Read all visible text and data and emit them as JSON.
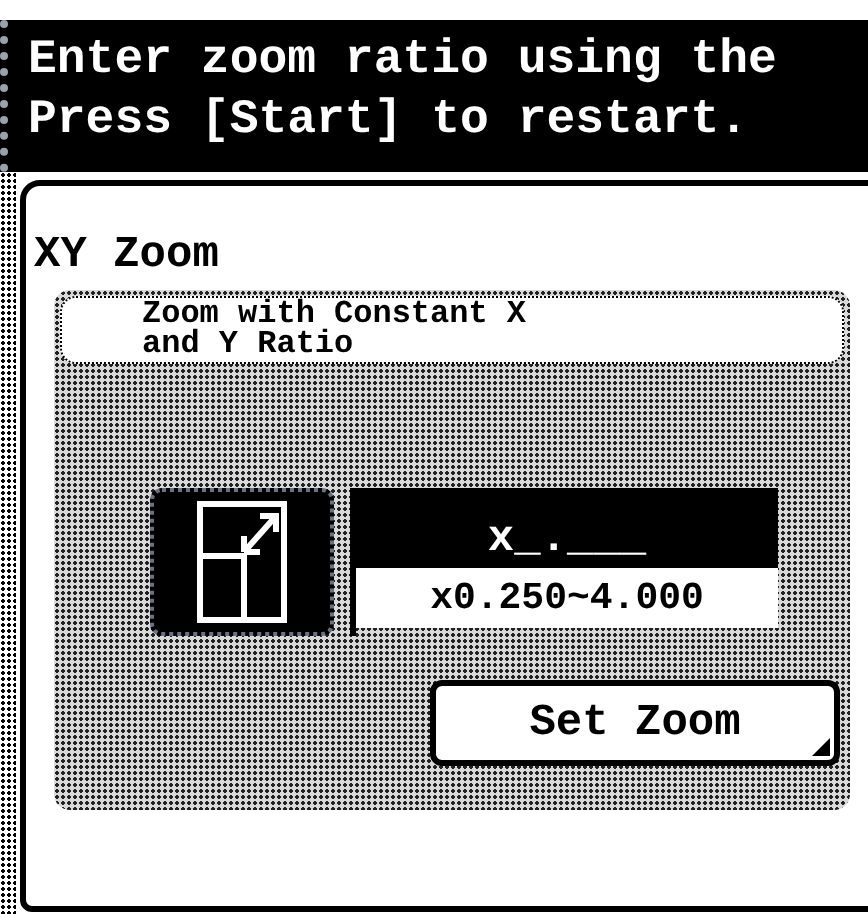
{
  "message": {
    "lines": [
      "Enter zoom ratio using the",
      "Press [Start] to restart."
    ]
  },
  "panel": {
    "title": "XY Zoom",
    "subtitle": "Zoom with Constant X and Y Ratio",
    "input": {
      "value": "x_.___",
      "range": "x0.250~4.000"
    },
    "buttons": [
      "Set Zoom"
    ]
  }
}
